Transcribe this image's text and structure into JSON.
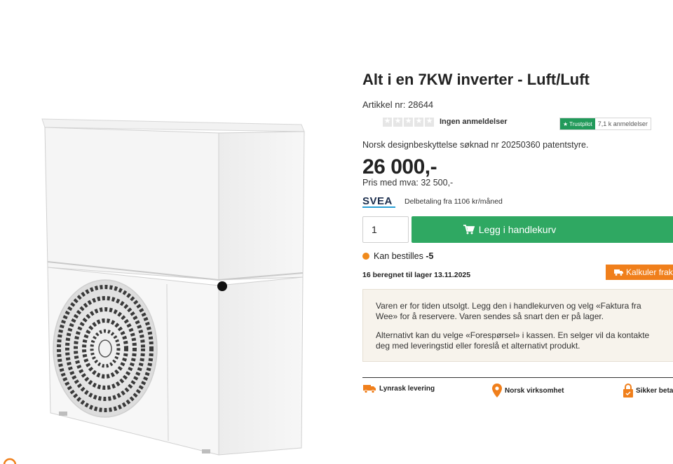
{
  "product": {
    "title": "Alt i en 7KW inverter - Luft/Luft",
    "article_number": "Artikkel nr: 28644",
    "reviews_text": "Ingen anmeldelser",
    "rating_stars": 0,
    "rating_max": 5,
    "design_protection": "Norsk designbeskyttelse søknad nr 20250360 patentstyre.",
    "price": "26 000,-",
    "price_with_vat": "Pris med mva: 32 500,-",
    "image_icon": "heat-pump-unit-icon"
  },
  "trustpilot": {
    "badge": "Trustpilot",
    "reviews": "7,1 k anmeldelser"
  },
  "financing": {
    "logo": "SVEA",
    "installment": "Delbetaling fra 1106 kr/måned"
  },
  "purchase": {
    "quantity": "1",
    "add_to_cart_label": "Legg i handlekurv"
  },
  "stock": {
    "status_label": "Kan bestilles",
    "status_count": "-5",
    "expected": "16 beregnet til lager 13.11.2025",
    "calculate_label": "Kalkuler frak"
  },
  "notice": {
    "paragraph_1": "Varen er for tiden utsolgt. Legg den i handlekurven og velg «Faktura fra Wee» for å reservere. Varen sendes så snart den er på lager.",
    "paragraph_2": "Alternativt kan du velge «Forespørsel» i kassen. En selger vil da kontakte deg med leveringstid eller foreslå et alternativt produkt."
  },
  "usps": [
    {
      "label": "Lynrask levering",
      "icon": "truck-icon"
    },
    {
      "label": "Norsk virksomhet",
      "icon": "location-pin-icon"
    },
    {
      "label": "Sikker betal",
      "icon": "lock-icon"
    }
  ],
  "colors": {
    "primary_green": "#2fa862",
    "accent_orange": "#f07f1b",
    "stock_orange": "#f08a1c",
    "trustpilot_green": "#219a5a",
    "svea_navy": "#1d2f4e"
  }
}
